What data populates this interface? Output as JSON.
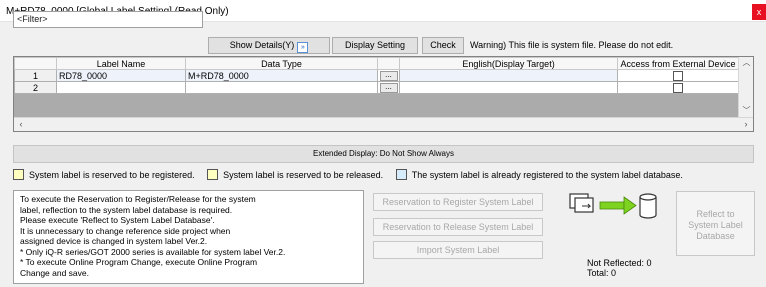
{
  "window": {
    "title": "M+RD78_0000 [Global Label Setting] (Read Only)",
    "close_glyph": "x"
  },
  "toolbar": {
    "filter_value": "<Filter>",
    "show_details_label": "Show Details(Y)",
    "display_setting_label": "Display Setting",
    "check_label": "Check",
    "warning_text": "Warning) This file is system file. Please do not edit."
  },
  "grid": {
    "columns": [
      "Label Name",
      "Data Type",
      "English(Display Target)",
      "Access from External Device"
    ],
    "rows": [
      {
        "no": "1",
        "label_name": "RD78_0000",
        "data_type": "M+RD78_0000",
        "english": "",
        "access_checked": false
      },
      {
        "no": "2",
        "label_name": "",
        "data_type": "",
        "english": "",
        "access_checked": false
      }
    ],
    "ellipsis": "..."
  },
  "extended_display": "Extended Display: Do Not Show Always",
  "legend": [
    {
      "text": "System label is reserved to be registered.",
      "color": "#ffffc0"
    },
    {
      "text": "System label is reserved to be released.",
      "color": "#ffffc0"
    },
    {
      "text": "The system label is already registered to the system label database.",
      "color": "#d6ecfa"
    }
  ],
  "info_text": "To execute the Reservation to Register/Release for the system\nlabel, reflection to the system label database is required.\nPlease execute 'Reflect to System Label Database'.\nIt is unnecessary to change reference side project when\nassigned device is changed in system label Ver.2.\n* Only iQ-R series/GOT 2000 series is available for system label Ver.2.\n* To execute Online Program Change, execute Online Program\nChange and save.",
  "actions": {
    "reserve_register": "Reservation to Register System Label",
    "reserve_release": "Reservation to Release System Label",
    "import_label": "Import System Label",
    "reflect_line1": "Reflect to",
    "reflect_line2": "System Label",
    "reflect_line3": "Database"
  },
  "status": {
    "not_reflected": "Not Reflected: 0",
    "total": "Total: 0"
  },
  "icons": [
    "document-icon",
    "arrow-right-icon",
    "database-icon",
    "close-icon",
    "expand-toggle-icon"
  ]
}
